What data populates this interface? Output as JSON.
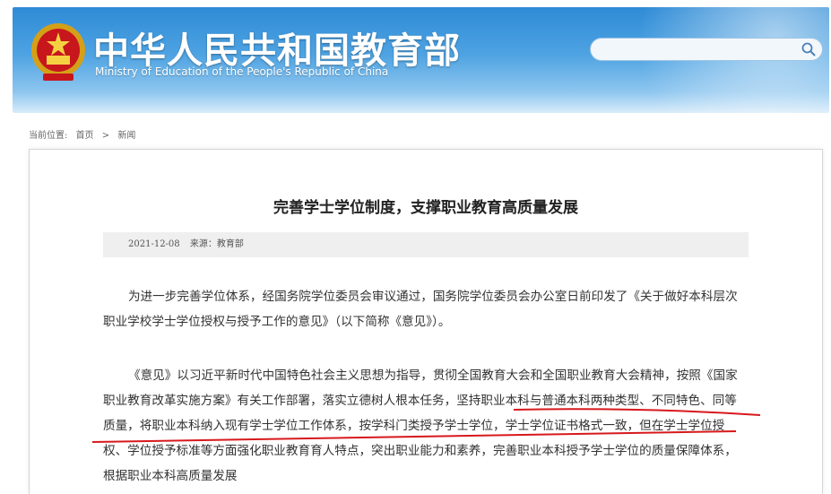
{
  "header": {
    "site_title": "中华人民共和国教育部",
    "site_subtitle": "Ministry of Education of the People's Republic of China",
    "search_placeholder": "",
    "colors": {
      "banner": "#2f8bd6",
      "text": "#ffffff"
    },
    "icons": {
      "emblem": "national-emblem-icon",
      "search": "search-icon"
    }
  },
  "breadcrumb": {
    "prefix": "当前位置:",
    "items": [
      "首页",
      "新闻"
    ],
    "separator": ">"
  },
  "article": {
    "title": "完善学士学位制度，支撑职业教育高质量发展",
    "date": "2021-12-08",
    "source": "来源：教育部",
    "paragraphs": [
      "为进一步完善学位体系，经国务院学位委员会审议通过，国务院学位委员会办公室日前印发了《关于做好本科层次职业学校学士学位授权与授予工作的意见》（以下简称《意见》）。",
      "《意见》以习近平新时代中国特色社会主义思想为指导，贯彻全国教育大会和全国职业教育大会精神，按照《国家职业教育改革实施方案》有关工作部署，落实立德树人根本任务，坚持职业本科与普通本科两种类型、不同特色、同等质量，将职业本科纳入现有学士学位工作体系，按学科门类授予学士学位，学士学位证书格式一致，但在学士学位授权、学位授予标准等方面强化职业教育育人特点，突出职业能力和素养，完善职业本科授予学士学位的质量保障体系，根据职业本科高质量发展"
    ],
    "annotation": {
      "underline_color": "#d7191c"
    }
  }
}
